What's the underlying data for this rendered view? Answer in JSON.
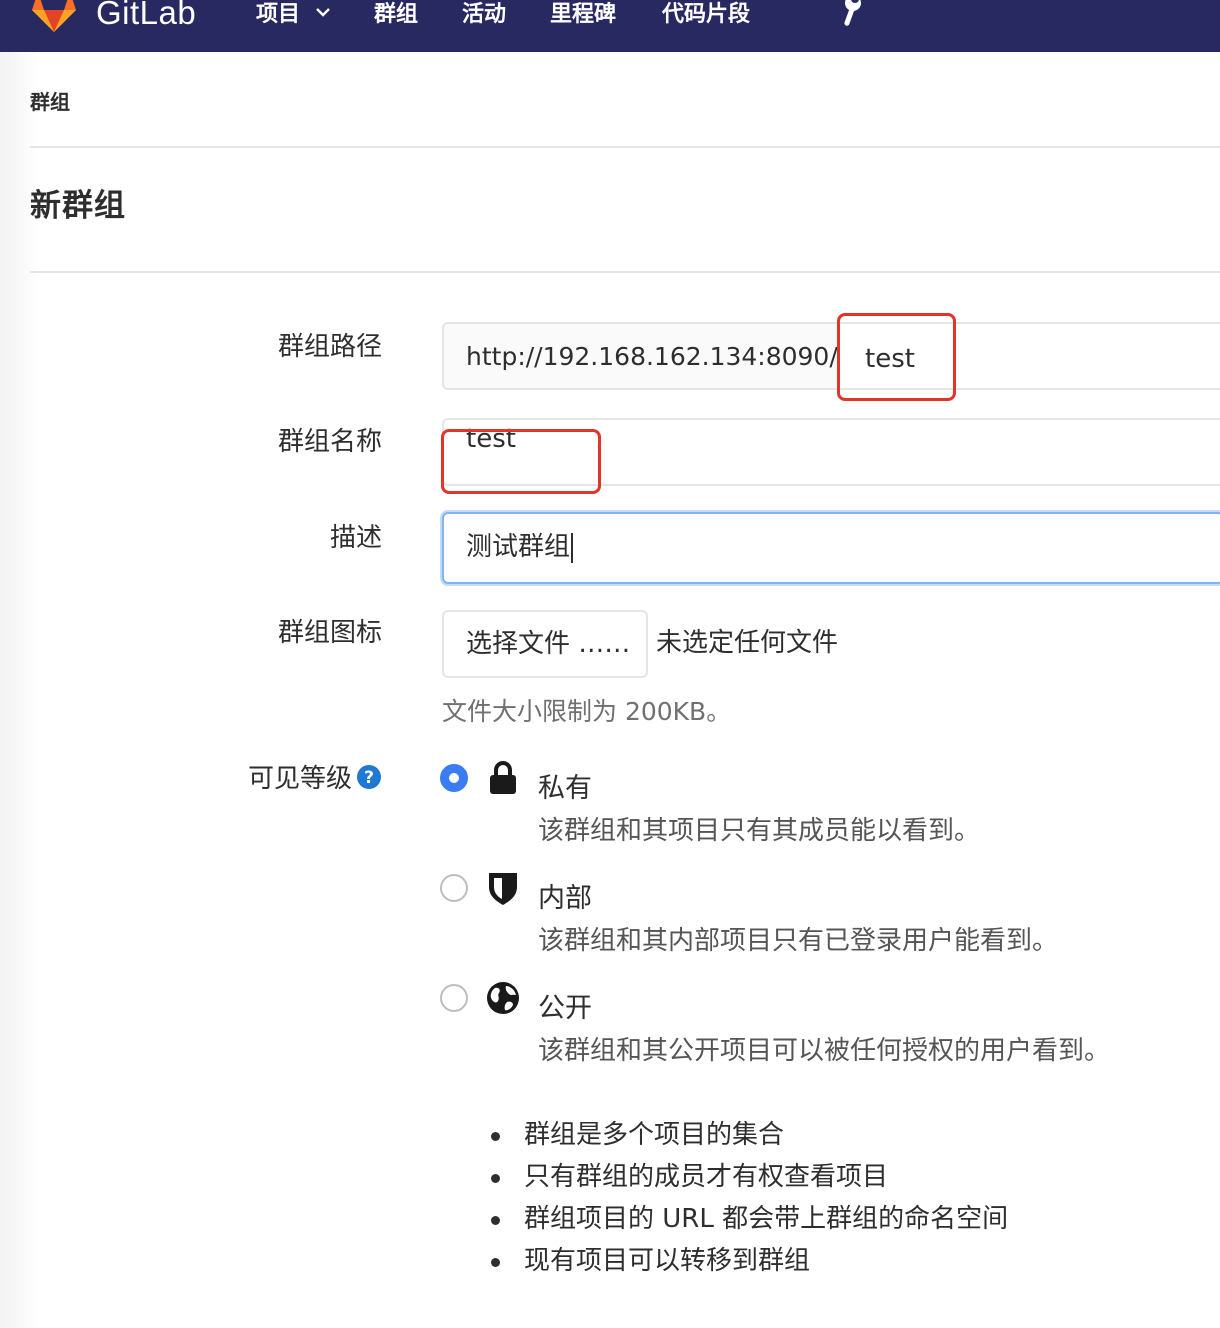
{
  "navbar": {
    "brand": "GitLab",
    "items": [
      {
        "label": "项目"
      },
      {
        "label": "群组"
      },
      {
        "label": "活动"
      },
      {
        "label": "里程碑"
      },
      {
        "label": "代码片段"
      }
    ],
    "icons": {
      "logo": "gitlab-tanuki-icon",
      "dropdown": "chevron-down-icon",
      "admin": "wrench-icon"
    },
    "bg_color": "#292961"
  },
  "breadcrumb": "群组",
  "page_title": "新群组",
  "form": {
    "path": {
      "label": "群组路径",
      "prefix": "http://192.168.162.134:8090/",
      "value": "test"
    },
    "name": {
      "label": "群组名称",
      "value": "test"
    },
    "description": {
      "label": "描述",
      "value": "测试群组"
    },
    "avatar": {
      "label": "群组图标",
      "button": "选择文件 ……",
      "status": "未选定任何文件",
      "help": "文件大小限制为 200KB。"
    },
    "visibility": {
      "label": "可见等级",
      "help_icon": "question-circle-icon",
      "options": [
        {
          "title": "私有",
          "description": "该群组和其项目只有其成员能以看到。",
          "icon": "lock-icon",
          "selected": true
        },
        {
          "title": "内部",
          "description": "该群组和其内部项目只有已登录用户能看到。",
          "icon": "shield-icon",
          "selected": false
        },
        {
          "title": "公开",
          "description": "该群组和其公开项目可以被任何授权的用户看到。",
          "icon": "globe-icon",
          "selected": false
        }
      ]
    }
  },
  "notes": [
    "群组是多个项目的集合",
    "只有群组的成员才有权查看项目",
    "群组项目的 URL 都会带上群组的命名空间",
    "现有项目可以转移到群组"
  ],
  "colors": {
    "highlight": "#e0352b",
    "radio_selected": "#3a7cf2",
    "focus_border": "#7fb4f0"
  }
}
